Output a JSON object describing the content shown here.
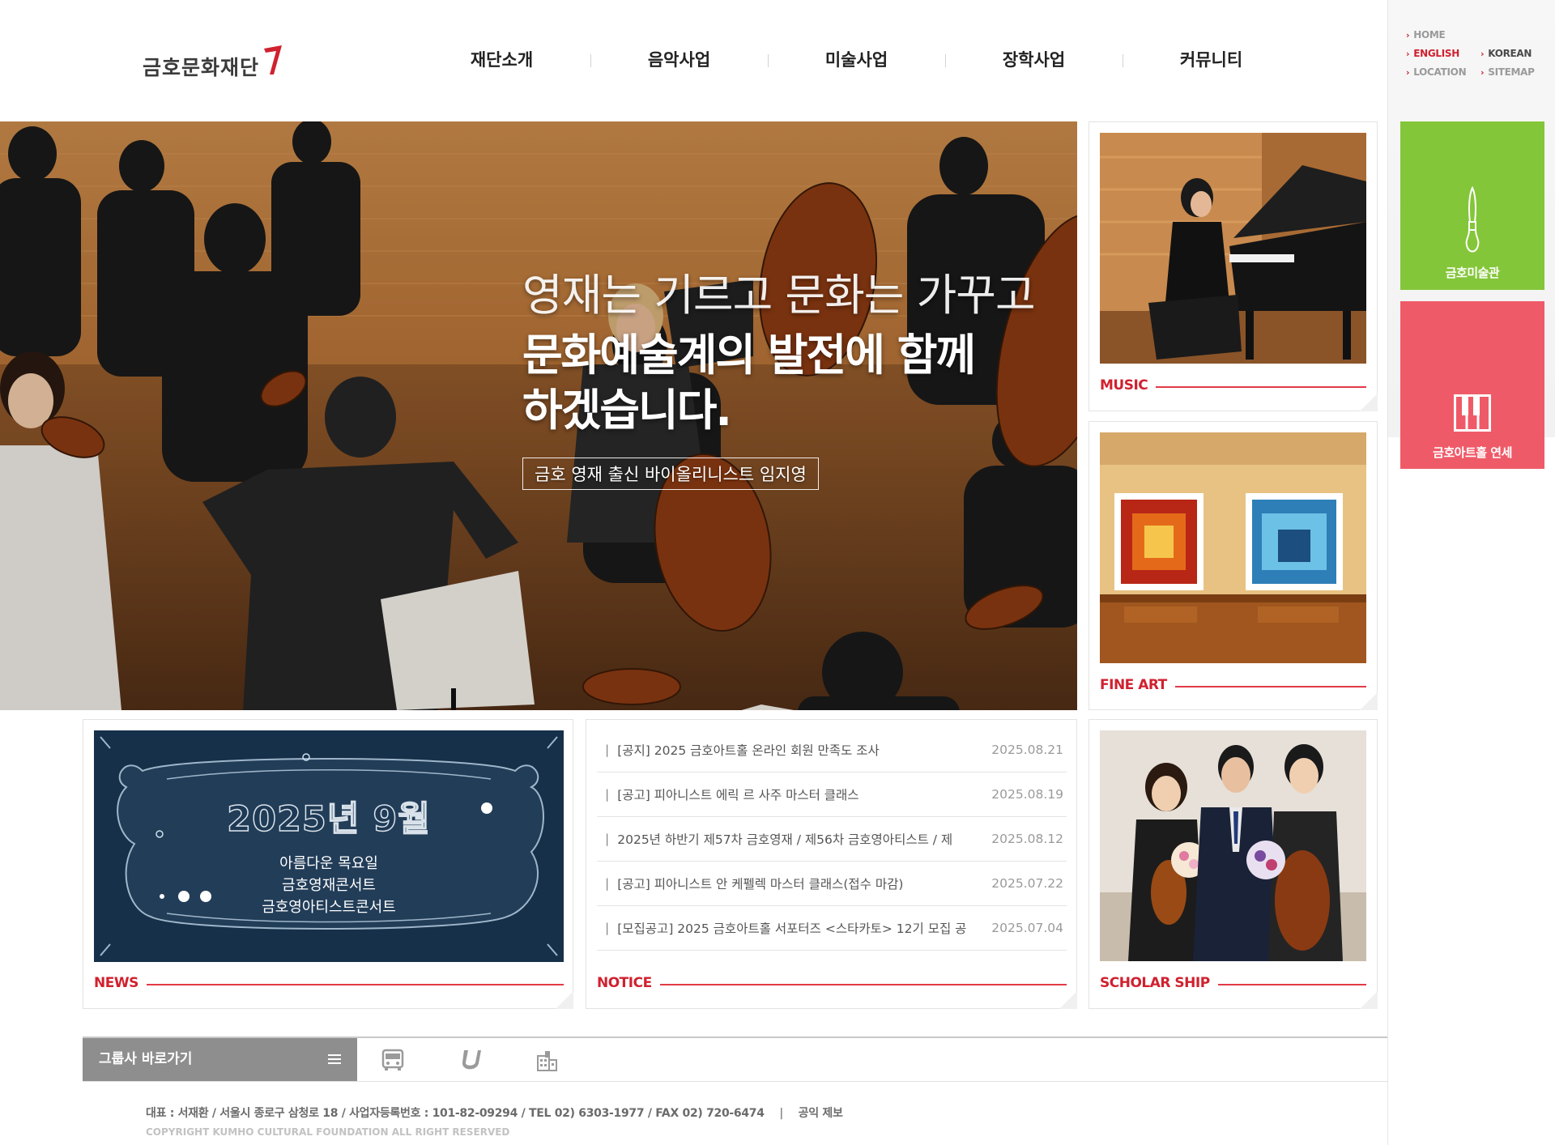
{
  "brand": {
    "name": "금호문화재단",
    "accent": "#d0212f"
  },
  "gnb": [
    "재단소개",
    "음악사업",
    "미술사업",
    "장학사업",
    "커뮤니티"
  ],
  "util_links": {
    "home": "HOME",
    "english": "ENGLISH",
    "korean": "KOREAN",
    "location": "LOCATION",
    "sitemap": "SITEMAP"
  },
  "quick_links": {
    "gallery": {
      "label": "금호미술관",
      "color": "#84c639",
      "icon": "paintbrush-icon"
    },
    "hall": {
      "label": "금호아트홀 연세",
      "color": "#ef5a68",
      "icon": "piano-keys-icon"
    }
  },
  "hero": {
    "line1": "영재는 기르고 문화는 가꾸고",
    "line2": "문화예술계의 발전에 함께 하겠습니다.",
    "caption": "금호 영재 출신 바이올리니스트 임지영"
  },
  "cards": {
    "music": "MUSIC",
    "fine_art": "FINE ART",
    "scholarship": "SCHOLAR SHIP",
    "news": "NEWS",
    "notice": "NOTICE"
  },
  "news_banner": {
    "year_month": "2025년 9월",
    "lines": [
      "아름다운 목요일",
      "금호영재콘서트",
      "금호영아티스트콘서트"
    ]
  },
  "notices": [
    {
      "title": "[공지] 2025 금호아트홀 온라인 회원 만족도 조사",
      "date": "2025.08.21"
    },
    {
      "title": "[공고] 피아니스트 에릭 르 사주 마스터 클래스",
      "date": "2025.08.19"
    },
    {
      "title": "2025년 하반기 제57차 금호영재 / 제56차 금호영아티스트 / 제",
      "date": "2025.08.12"
    },
    {
      "title": "[공고] 피아니스트 안 케펠렉 마스터 클래스(접수 마감)",
      "date": "2025.07.22"
    },
    {
      "title": "[모집공고] 2025 금호아트홀 서포터즈 <스타카토> 12기 모집 공",
      "date": "2025.07.04"
    }
  ],
  "group_bar": {
    "label": "그룹사 바로가기",
    "icons": [
      "bus-icon",
      "u-logo-icon",
      "building-icon"
    ]
  },
  "footer": {
    "info": "대표 : 서재환 / 서울시 종로구 삼청로 18 / 사업자등록번호 : 101-82-09294 / TEL 02) 6303-1977 / FAX 02) 720-6474",
    "separator": "|",
    "report": "공익 제보",
    "copyright": "COPYRIGHT KUMHO CULTURAL FOUNDATION ALL RIGHT RESERVED"
  }
}
